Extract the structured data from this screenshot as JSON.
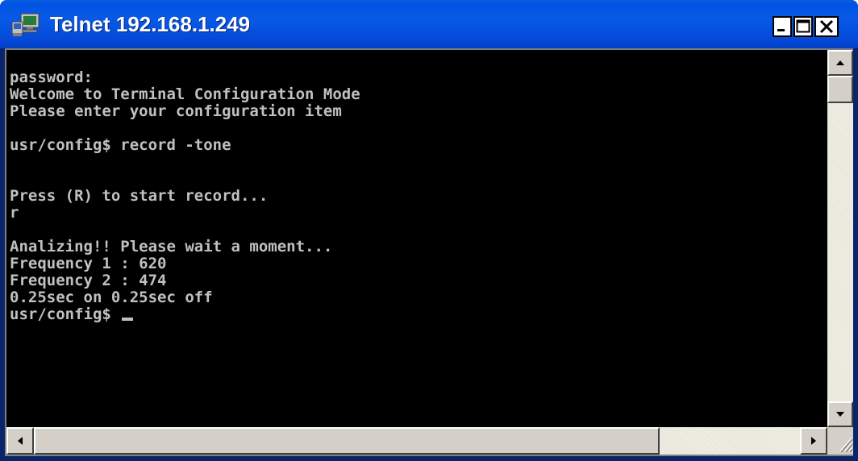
{
  "window": {
    "title": "Telnet 192.168.1.249",
    "icon": "telnet-computer-icon"
  },
  "title_buttons": {
    "minimize": "minimize-icon",
    "maximize": "maximize-icon",
    "close": "close-icon"
  },
  "terminal": {
    "lines": [
      "password:",
      "Welcome to Terminal Configuration Mode",
      "Please enter your configuration item",
      "",
      "usr/config$ record -tone",
      "",
      "",
      "Press (R) to start record...",
      "r",
      "",
      "Analizing!! Please wait a moment...",
      "Frequency 1 : 620",
      "Frequency 2 : 474",
      "0.25sec on 0.25sec off",
      "usr/config$ "
    ],
    "colors": {
      "background": "#000000",
      "foreground": "#C0C0C0"
    }
  },
  "scrollbars": {
    "vertical": {
      "up": "arrow-up-icon",
      "down": "arrow-down-icon"
    },
    "horizontal": {
      "left": "arrow-left-icon",
      "right": "arrow-right-icon"
    }
  },
  "colors": {
    "title_bar": "#0054E3",
    "frame": "#0A246A",
    "chrome": "#D4D0C8"
  }
}
